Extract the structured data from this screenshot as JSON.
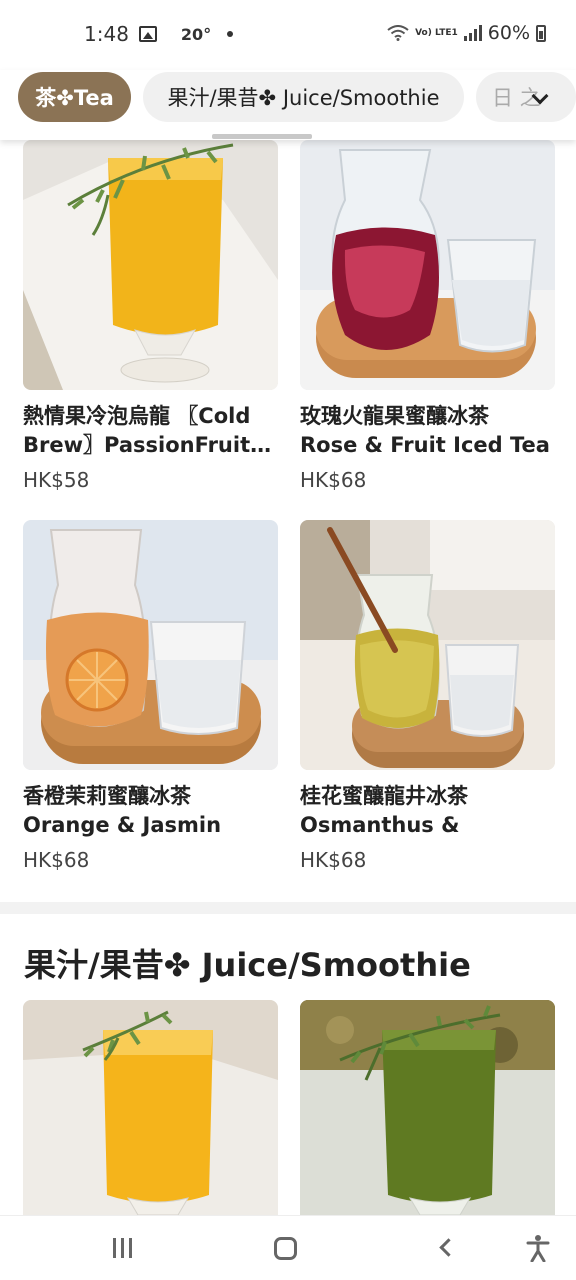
{
  "status_bar": {
    "time": "1:48",
    "temperature": "20°",
    "battery": "60%",
    "network": "Vo) LTE1"
  },
  "categories": {
    "active": "茶✤Tea",
    "juice": "果汁/果昔✤ Juice/Smoothie",
    "more_partial": "日 之"
  },
  "products": [
    {
      "title": "熱情果冷泡烏龍 〖Cold\nBrew〗PassionFruit…",
      "price": "HK$58"
    },
    {
      "title": "玫瑰火龍果蜜釀冰茶\nRose & Fruit Iced Tea",
      "price": "HK$68"
    },
    {
      "title": "香橙茉莉蜜釀冰茶\nOrange & Jasmin Ice…",
      "price": "HK$68"
    },
    {
      "title": "桂花蜜釀龍井冰茶\nOsmanthus & Longji…",
      "price": "HK$68"
    }
  ],
  "section": {
    "title": "果汁/果昔✤ Juice/Smoothie"
  },
  "colors": {
    "accent_chip": "#8b7355",
    "chip_bg": "#f0f0f0",
    "divider": "#f2f2f2"
  },
  "icons": [
    "gallery-icon",
    "wifi-icon",
    "signal-icon",
    "battery-icon",
    "chevron-down-icon",
    "recent-apps-icon",
    "home-icon",
    "back-icon",
    "accessibility-icon"
  ]
}
